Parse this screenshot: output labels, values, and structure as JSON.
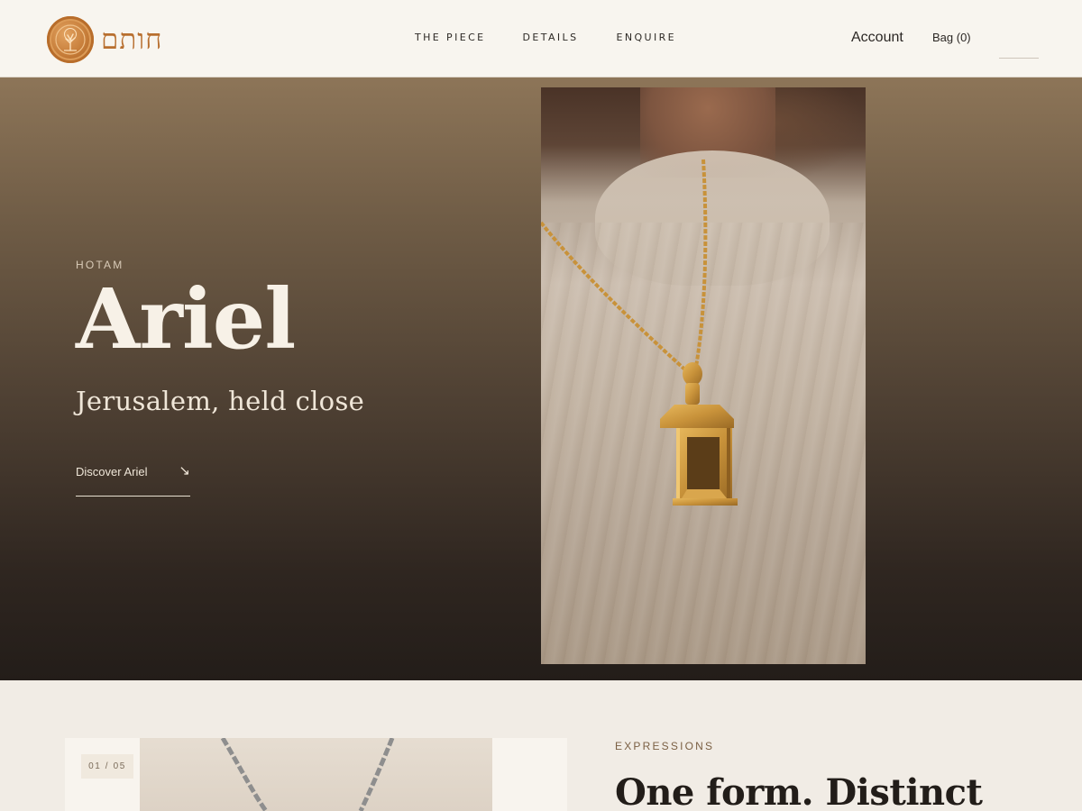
{
  "brand": {
    "name": "חותם",
    "seal_icon": "tree-seal-icon",
    "accent": "#b86f2f"
  },
  "nav": {
    "items": [
      "THE PIECE",
      "DETAILS",
      "ENQUIRE"
    ]
  },
  "header": {
    "account_label": "Account",
    "bag_label": "Bag (0)"
  },
  "hero": {
    "eyebrow": "HOTAM",
    "title": "Ariel",
    "subtitle": "Jerusalem, held close",
    "cta_label": "Discover Ariel",
    "cta_icon": "arrow-down-right-icon"
  },
  "expressions": {
    "counter": "01 / 05",
    "eyebrow": "EXPRESSIONS",
    "title": "One form. Distinct"
  },
  "colors": {
    "header_bg": "#f8f5ef",
    "page_bg": "#f1ece5",
    "hero_top": "#8d7558",
    "hero_bottom": "#231d19",
    "gold": "#c89a3a"
  }
}
